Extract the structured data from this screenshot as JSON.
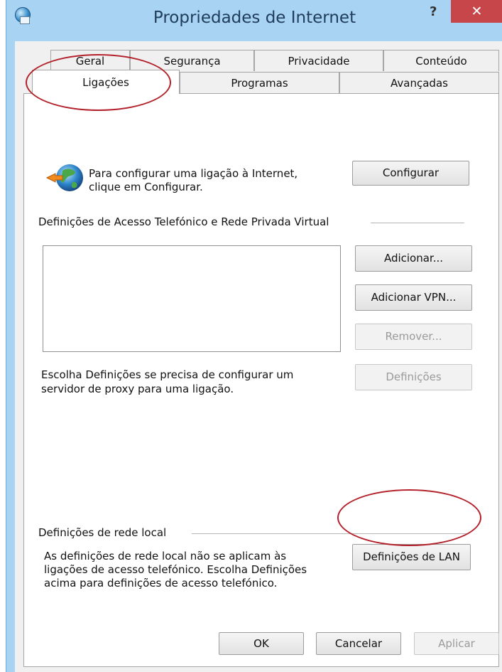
{
  "window": {
    "title": "Propriedades de Internet",
    "help_label": "?",
    "close_label": "✕"
  },
  "tabs": {
    "row_top": [
      "Geral",
      "Segurança",
      "Privacidade",
      "Conteúdo"
    ],
    "row_bottom": [
      "Ligações",
      "Programas",
      "Avançadas"
    ],
    "active": "Ligações"
  },
  "setup": {
    "text_line1": "Para configurar uma ligação à Internet,",
    "text_line2": "clique em Configurar.",
    "button": "Configurar"
  },
  "dialup": {
    "section_label": "Definições de Acesso Telefónico e Rede Privada Virtual",
    "add_button": "Adicionar...",
    "add_vpn_button": "Adicionar VPN...",
    "remove_button": "Remover...",
    "settings_button": "Definições",
    "proxy_text_line1": "Escolha Definições se precisa de configurar um",
    "proxy_text_line2": "servidor de proxy para uma ligação."
  },
  "lan": {
    "section_label": "Definições de rede local",
    "text_line1": "As definições de rede local não se aplicam às",
    "text_line2": "ligações de acesso telefónico. Escolha Definições",
    "text_line3": "acima para definições de acesso telefónico.",
    "button": "Definições de LAN"
  },
  "footer": {
    "ok": "OK",
    "cancel": "Cancelar",
    "apply": "Aplicar"
  },
  "colors": {
    "annotation": "#b3202a",
    "close_button": "#c7464a",
    "titlebar": "#a8d3f3"
  }
}
